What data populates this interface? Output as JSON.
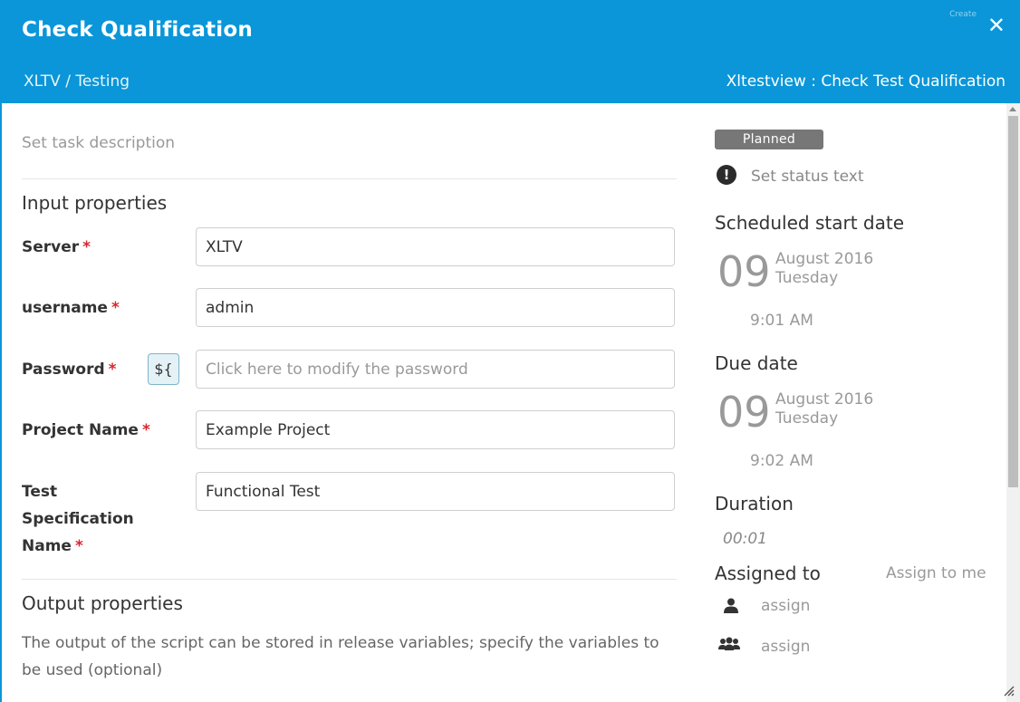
{
  "header": {
    "title": "Check Qualification",
    "close_glyph": "✕",
    "faint_text": "Create",
    "breadcrumb": "XLTV / Testing",
    "task_type": "Xltestview : Check Test Qualification"
  },
  "left": {
    "description_placeholder": "Set task description",
    "input_section_title": "Input properties",
    "fields": [
      {
        "label": "Server",
        "required": "*",
        "value": "XLTV"
      },
      {
        "label": "username",
        "required": "*",
        "value": "admin"
      },
      {
        "label": "Password",
        "required": "*",
        "variable_button": "${",
        "placeholder": "Click here to modify the password"
      },
      {
        "label": "Project Name",
        "required": "*",
        "value": "Example Project"
      },
      {
        "label_lines": [
          "Test",
          "Specification",
          "Name"
        ],
        "required": "*",
        "value": "Functional Test"
      }
    ],
    "output_section_title": "Output properties",
    "output_text": "The output of the script can be stored in release variables; specify the variables to be used (optional)"
  },
  "right": {
    "status_badge": "Planned",
    "status_icon": "exclamation-circle-icon",
    "status_icon_glyph": "!",
    "status_text": "Set status text",
    "scheduled_start": {
      "heading": "Scheduled start date",
      "day": "09",
      "month_year": "August 2016",
      "weekday": "Tuesday",
      "time": "9:01 AM"
    },
    "due": {
      "heading": "Due date",
      "day": "09",
      "month_year": "August 2016",
      "weekday": "Tuesday",
      "time": "9:02 AM"
    },
    "duration": {
      "heading": "Duration",
      "value": "00:01"
    },
    "assigned": {
      "heading": "Assigned to",
      "assign_to_me": "Assign to me",
      "user_assign": "assign",
      "team_assign": "assign"
    }
  },
  "colors": {
    "header_bg": "#0a96d8",
    "badge_bg": "#777777",
    "required": "#d9262d"
  }
}
